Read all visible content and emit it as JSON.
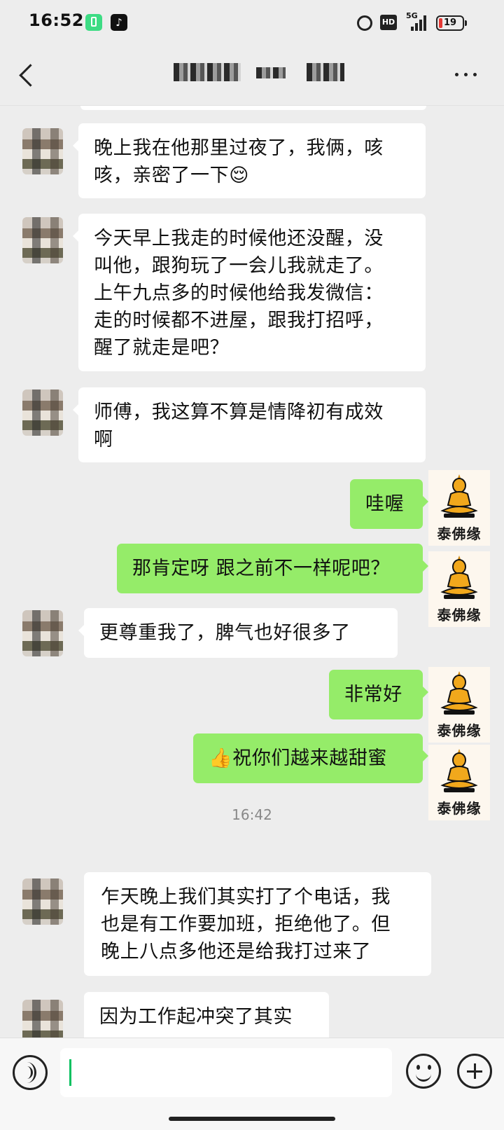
{
  "status_bar": {
    "time": "16:52",
    "network": "5G",
    "hd_label": "HD",
    "battery_level": "19",
    "battery_color": "#e53935"
  },
  "nav": {
    "title": "██ █ ██  ██"
  },
  "messages": [
    {
      "side": "left",
      "text": "晚上我在他那里过夜了，我俩，咳\n咳，亲密了一下😌"
    },
    {
      "side": "left",
      "text": "今天早上我走的时候他还没醒，没\n叫他，跟狗玩了一会儿我就走了。\n上午九点多的时候他给我发微信：\n走的时候都不进屋，跟我打招呼，\n醒了就走是吧？"
    },
    {
      "side": "left",
      "text": "师傅，我这算不算是情降初有成效\n啊"
    },
    {
      "side": "right",
      "text": "哇喔"
    },
    {
      "side": "right",
      "text": "那肯定呀 跟之前不一样呢吧？"
    },
    {
      "side": "left",
      "text": "更尊重我了，脾气也好很多了"
    },
    {
      "side": "right",
      "text": "非常好"
    },
    {
      "side": "right",
      "text": "👍祝你们越来越甜蜜"
    },
    {
      "side": "left",
      "text": "乍天晚上我们其实打了个电话，我\n也是有工作要加班，拒绝他了。但\n晚上八点多他还是给我打过来了"
    },
    {
      "side": "left",
      "text": "因为工作起冲突了其实"
    }
  ],
  "timestamp": "16:42",
  "my_avatar_brand": "泰佛缘",
  "colors": {
    "sent_bubble": "#95ec69",
    "received_bubble": "#ffffff",
    "background": "#ededed",
    "caret": "#07c160"
  },
  "input": {
    "value": "",
    "placeholder": ""
  },
  "icons": {
    "back": "back-arrow-icon",
    "more": "more-icon",
    "voice": "voice-icon",
    "emoji": "emoji-icon",
    "plus": "plus-icon"
  }
}
